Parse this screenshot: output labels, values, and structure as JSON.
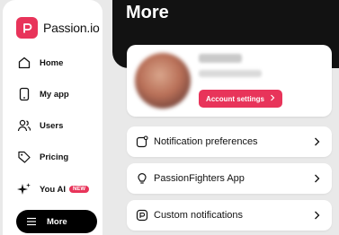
{
  "brand": {
    "name": "Passion.io",
    "accent": "#e8345a"
  },
  "sidebar": {
    "items": [
      {
        "label": "Home",
        "icon": "home-icon"
      },
      {
        "label": "My app",
        "icon": "phone-icon"
      },
      {
        "label": "Users",
        "icon": "users-icon"
      },
      {
        "label": "Pricing",
        "icon": "tag-icon"
      },
      {
        "label": "You AI",
        "icon": "sparkle-icon",
        "badge": "NEW"
      },
      {
        "label": "More",
        "icon": "menu-icon",
        "active": true
      }
    ]
  },
  "main": {
    "title": "More",
    "profile": {
      "account_button": "Account settings"
    },
    "rows": [
      {
        "label": "Notification preferences",
        "icon": "notification-icon"
      },
      {
        "label": "PassionFighters App",
        "icon": "bulb-icon"
      },
      {
        "label": "Custom notifications",
        "icon": "custom-notification-icon"
      }
    ]
  }
}
